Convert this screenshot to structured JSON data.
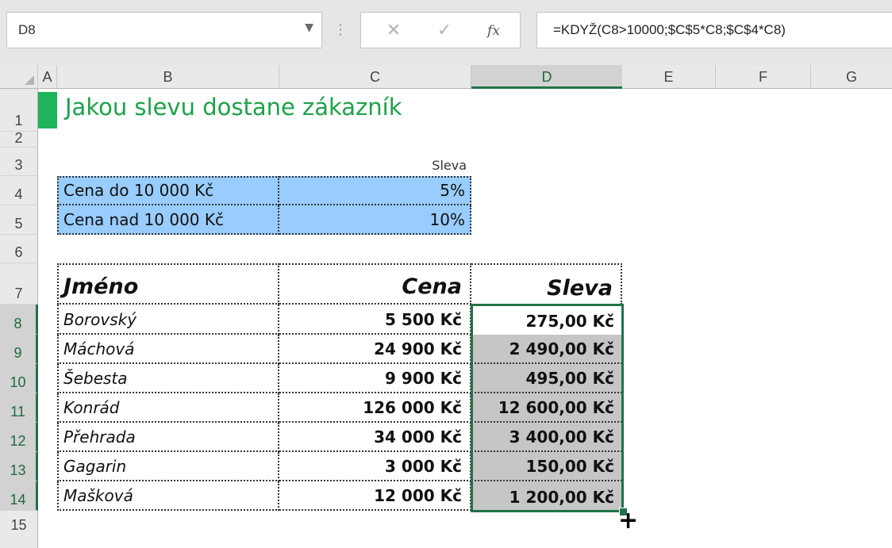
{
  "namebox": {
    "value": "D8",
    "dropdown_icon": "caret-down-icon"
  },
  "formula_bar": {
    "cancel_icon": "✕",
    "enter_icon": "✓",
    "fx_label": "fx",
    "formula": "=KDYŽ(C8>10000;$C$5*C8;$C$4*C8)"
  },
  "columns": [
    "A",
    "B",
    "C",
    "D",
    "E",
    "F",
    "G"
  ],
  "rows": [
    "1",
    "2",
    "3",
    "4",
    "5",
    "6",
    "7",
    "8",
    "9",
    "10",
    "11",
    "12",
    "13",
    "14",
    "15"
  ],
  "sheet": {
    "title": "Jakou slevu dostane zákazník",
    "discount_header": "Sleva",
    "discounts": [
      {
        "label": "Cena do 10 000 Kč",
        "value": "5%"
      },
      {
        "label": "Cena nad 10 000 Kč",
        "value": "10%"
      }
    ],
    "table_headers": {
      "name": "Jméno",
      "price": "Cena",
      "discount": "Sleva"
    },
    "table_rows": [
      {
        "name": "Borovský",
        "price": "5 500 Kč",
        "discount": "275,00 Kč"
      },
      {
        "name": "Máchová",
        "price": "24 900 Kč",
        "discount": "2 490,00 Kč"
      },
      {
        "name": "Šebesta",
        "price": "9 900 Kč",
        "discount": "495,00 Kč"
      },
      {
        "name": "Konrád",
        "price": "126 000 Kč",
        "discount": "12 600,00 Kč"
      },
      {
        "name": "Přehrada",
        "price": "34 000 Kč",
        "discount": "3 400,00 Kč"
      },
      {
        "name": "Gagarin",
        "price": "3 000 Kč",
        "discount": "150,00 Kč"
      },
      {
        "name": "Mašková",
        "price": "12 000 Kč",
        "discount": "1 200,00 Kč"
      }
    ]
  },
  "colors": {
    "accent": "#217346",
    "title": "#1ea14a",
    "blue_fill": "#99ccff",
    "selection_fill": "#c6c6c6"
  }
}
